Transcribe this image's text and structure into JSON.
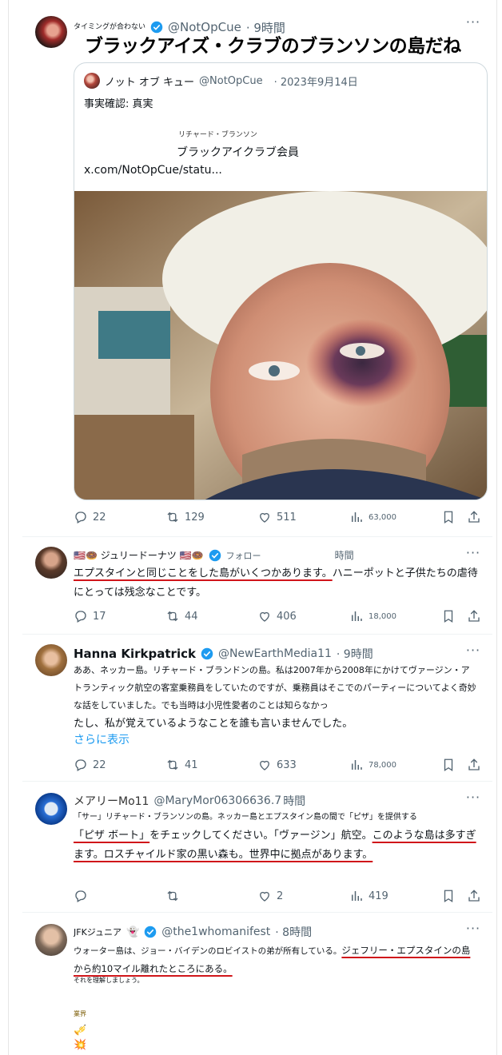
{
  "tweets": [
    {
      "small_label": "タイミングが合わない",
      "handle": "@NotOpCue",
      "time": "· 9時間",
      "headline": "ブラックアイズ・クラブのブランソンの島だね",
      "quote": {
        "name": "ノット オブ キュー",
        "handle": "@NotOpCue",
        "date": "· 2023年9月14日",
        "fact": "事実確認: 真実",
        "caption_small": "リチャード・ブランソン",
        "caption": "ブラックアイクラブ会員",
        "link": "x.com/NotOpCue/statu..."
      },
      "actions": {
        "replies": "22",
        "reposts": "129",
        "likes": "511",
        "views": "63,000"
      }
    },
    {
      "name": "🇺🇸🍩 ジュリードーナツ 🇺🇸🍩",
      "follow_label": "フォロー",
      "time": "時間",
      "text_underlined": "エプスタインと同じことをした島がいくつかあります。",
      "text_rest": "ハニーポットと子供たちの虐待にとっては残念なことです。",
      "actions": {
        "replies": "17",
        "reposts": "44",
        "likes": "406",
        "views": "18,000"
      }
    },
    {
      "name": "Hanna Kirkpatrick",
      "handle": "@NewEarthMedia11",
      "time": "· 9時間",
      "text_small": "ああ、ネッカー島。リチャード・ブランドンの島。私は2007年から2008年にかけてヴァージン・アトランティック航空の客室乗務員をしていたのですが、乗務員はそこでのパーティーについてよく奇妙な話をしていました。でも当時は小児性愛者のことは知らなかっ",
      "text_normal": "たし、私が覚えているようなことを誰も言いませんでした。",
      "show_more": "さらに表示",
      "actions": {
        "replies": "22",
        "reposts": "41",
        "likes": "633",
        "views": "78,000"
      }
    },
    {
      "name": "メアリーMo11",
      "handle": "@MaryMor06306636.7",
      "time": "時間",
      "text_small": "「サー」リチャード・ブランソンの島。ネッカー島とエプスタイン島の間で「ピザ」を提供する",
      "text_pizza": "「ピザ ボート」",
      "text_mid": "をチェックしてください。「ヴァージン」航空。",
      "text_ul2": "このような島は多すぎます。ロスチャイルド家の黒い森も。世界中に拠点があります。",
      "actions": {
        "replies": "",
        "reposts": "",
        "likes": "2",
        "views": "419"
      }
    },
    {
      "name": "JFKジュニア",
      "handle": "@the1whomanifest",
      "time": "· 8時間",
      "text_start": "ウォーター島は、ジョー・バイデンのロビイストの弟が所有している。",
      "text_ul": "ジェフリー・エプスタインの島から約10マイル離れたところにある。",
      "text_small": "それを理解しましょう。",
      "tag": "業界",
      "emoji1": "🎺",
      "emoji2": "💥"
    }
  ]
}
